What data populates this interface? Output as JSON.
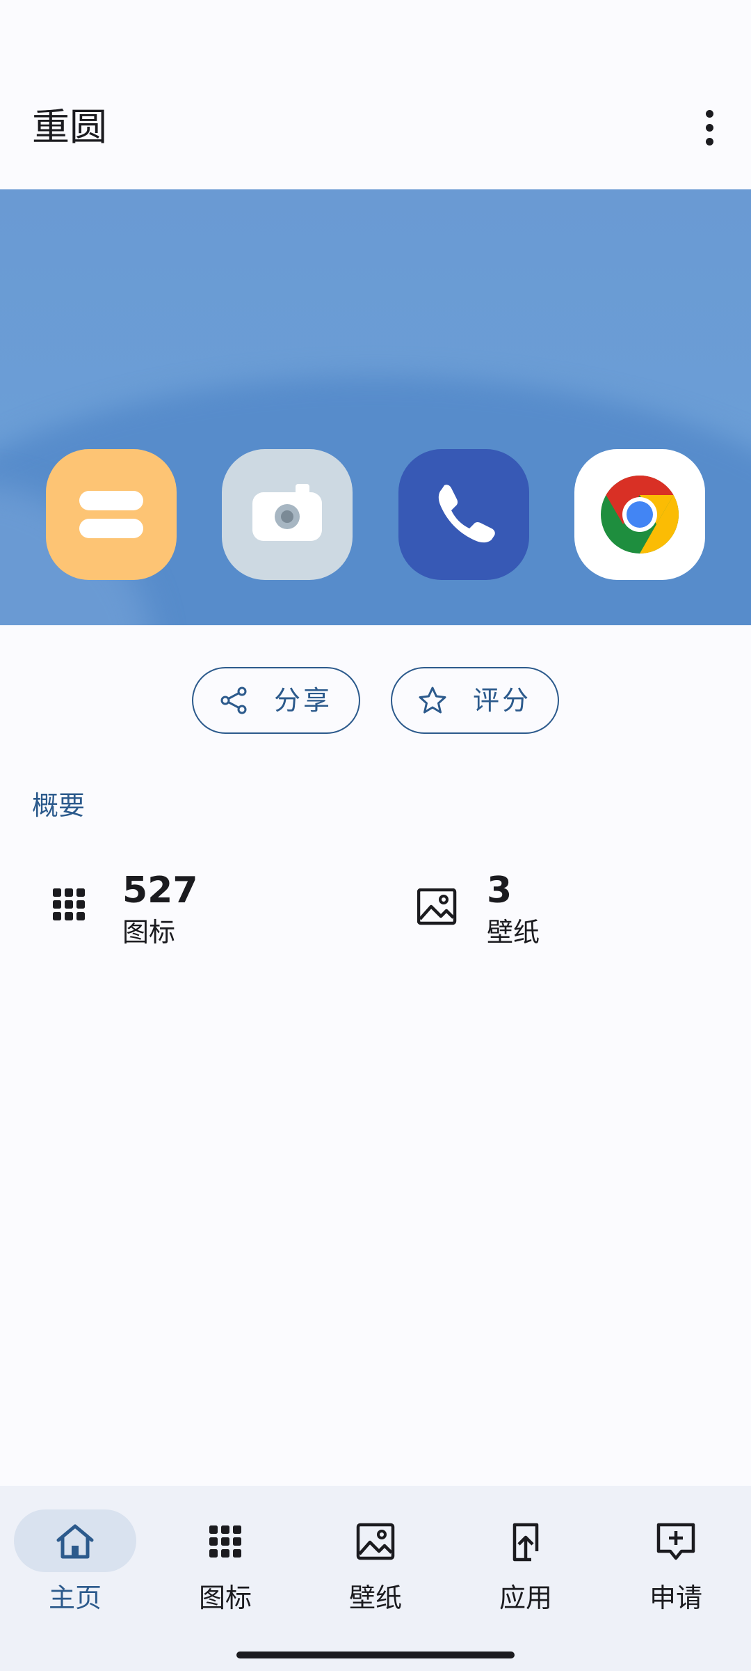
{
  "app_title": "重圆",
  "actions": {
    "share_label": "分享",
    "rate_label": "评分"
  },
  "overview": {
    "heading": "概要",
    "icons_count": "527",
    "icons_label": "图标",
    "wallpapers_count": "3",
    "wallpapers_label": "壁纸"
  },
  "preview_icons": [
    "notes-app-icon",
    "camera-app-icon",
    "phone-app-icon",
    "chrome-app-icon"
  ],
  "bottom_nav": {
    "items": [
      {
        "label": "主页",
        "icon": "home-icon",
        "active": true
      },
      {
        "label": "图标",
        "icon": "grid-icon",
        "active": false
      },
      {
        "label": "壁纸",
        "icon": "image-icon",
        "active": false
      },
      {
        "label": "应用",
        "icon": "apply-icon",
        "active": false
      },
      {
        "label": "申请",
        "icon": "request-icon",
        "active": false
      }
    ]
  },
  "colors": {
    "accent": "#2c5a8c",
    "hero_blue": "#6a9ad3",
    "nav_background": "#eef1f8",
    "active_indicator": "#d9e2ef"
  }
}
